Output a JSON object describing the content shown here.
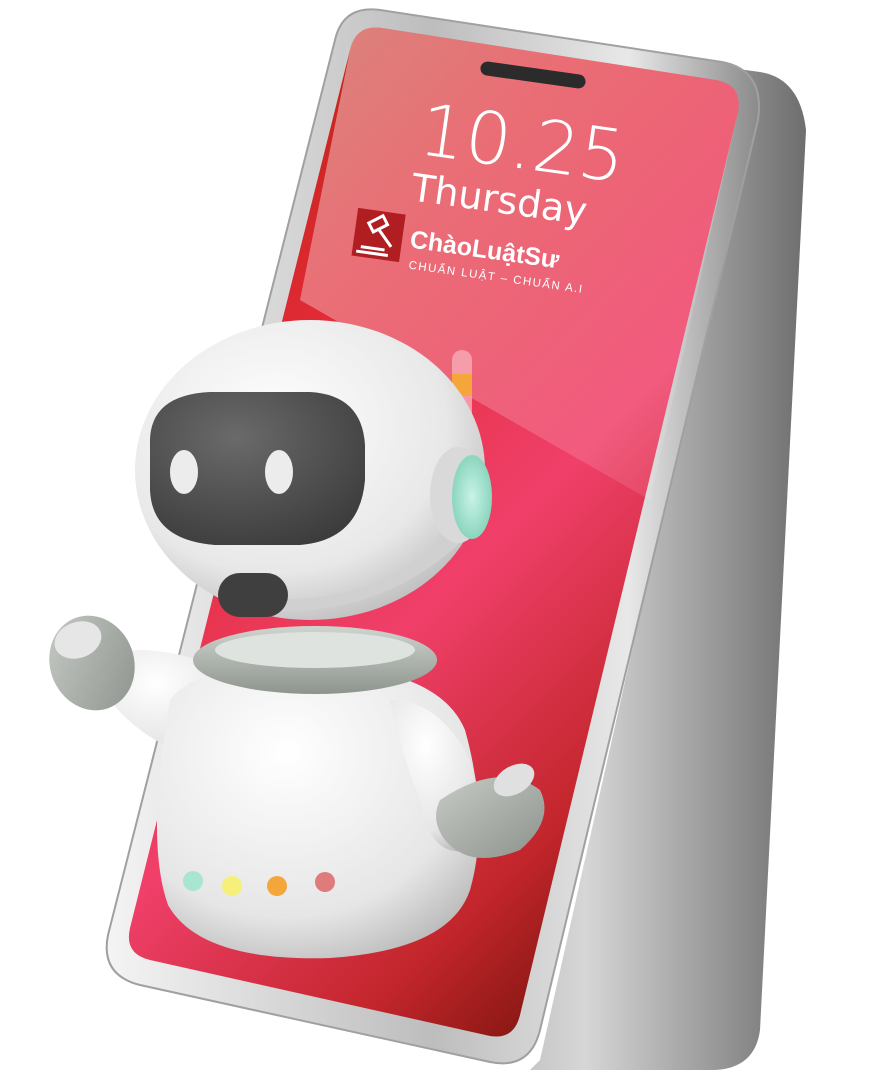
{
  "lock_screen": {
    "time": "10.25",
    "day": "Thursday"
  },
  "brand": {
    "logo_icon": "gavel-icon",
    "name": "ChàoLuậtSư",
    "tagline": "CHUẨN LUẬT – CHUẨN A.I"
  },
  "robot": {
    "status_lights": [
      "#a8e6cf",
      "#f6f07a",
      "#f4a63a",
      "#e07b7b"
    ]
  },
  "colors": {
    "screen_red": "#d8202f",
    "screen_pink": "#f0406a",
    "screen_dark": "#7a1208",
    "phone_frame": "#c9c9c9",
    "headset_accent": "#9fe3cf"
  }
}
